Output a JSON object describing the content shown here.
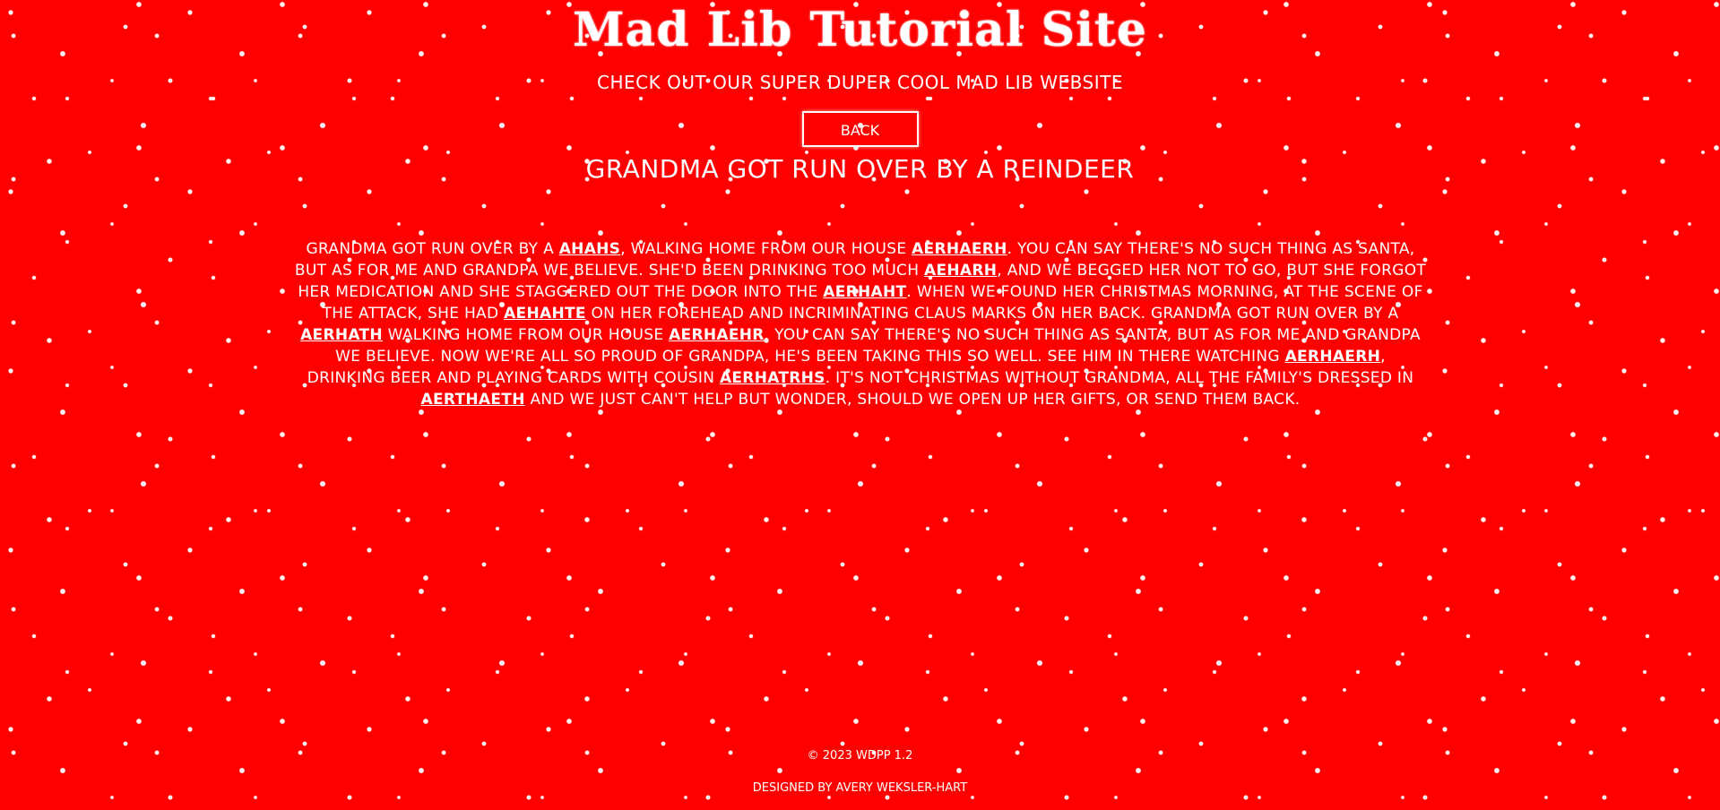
{
  "header": {
    "site_title": "Mad Lib Tutorial Site",
    "subtitle": "CHECK OUT OUR SUPER DUPER COOL MAD LIB WEBSITE",
    "back_label": "BACK"
  },
  "story": {
    "title": "GRANDMA GOT RUN OVER BY A REINDEER",
    "segments": [
      "GRANDMA GOT RUN OVER BY A ",
      "AHAHS",
      ", WALKING HOME FROM OUR HOUSE ",
      "AERHAERH",
      ". YOU CAN SAY THERE'S NO SUCH THING AS SANTA, BUT AS FOR ME AND GRANDPA WE BELIEVE. SHE'D BEEN DRINKING TOO MUCH ",
      "AEHARH",
      ", AND WE BEGGED HER NOT TO GO, BUT SHE FORGOT HER MEDICATION AND SHE STAGGERED OUT THE DOOR INTO THE ",
      "AERHAHT",
      ". WHEN WE FOUND HER CHRISTMAS MORNING, AT THE SCENE OF THE ATTACK, SHE HAD ",
      "AEHAHTE",
      " ON HER FOREHEAD AND INCRIMINATING CLAUS MARKS ON HER BACK. GRANDMA GOT RUN OVER BY A ",
      "AERHATH",
      " WALKING HOME FROM OUR HOUSE ",
      "AERHAEHR",
      ". YOU CAN SAY THERE'S NO SUCH THING AS SANTA, BUT AS FOR ME AND GRANDPA WE BELIEVE. NOW WE'RE ALL SO PROUD OF GRANDPA, HE'S BEEN TAKING THIS SO WELL. SEE HIM IN THERE WATCHING ",
      "AERHAERH",
      ", DRINKING BEER AND PLAYING CARDS WITH COUSIN ",
      "AERHATRHS",
      ". IT'S NOT CHRISTMAS WITHOUT GRANDMA, ALL THE FAMILY'S DRESSED IN ",
      "AERTHAETH",
      " AND WE JUST CAN'T HELP BUT WONDER, SHOULD WE OPEN UP HER GIFTS, OR SEND THEM BACK."
    ]
  },
  "footer": {
    "copyright": "© 2023 WDPP 1.2",
    "designer": "DESIGNED BY AVERY WEKSLER-HART"
  },
  "colors": {
    "background": "#ff0000",
    "text": "#ffffff"
  }
}
